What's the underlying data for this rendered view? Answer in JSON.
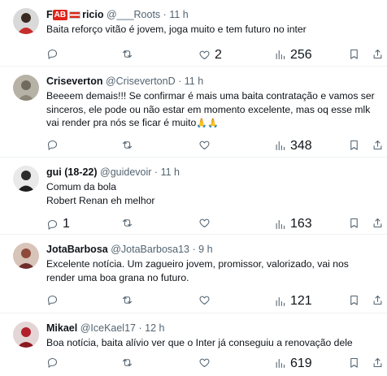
{
  "tweets": [
    {
      "name_prefix": "F",
      "name_badge": "AB",
      "name_suffix": "ricio",
      "handle": "@___Roots",
      "time": "11 h",
      "text": "Baita reforço vitão é jovem, joga muito e tem futuro no inter",
      "likes": "2",
      "views": "256",
      "avatar_colors": [
        "#c62d2d",
        "#3a2a22"
      ]
    },
    {
      "name": "Criseverton",
      "handle": "@CrisevertonD",
      "time": "11 h",
      "text": "Beeeem demais!!! Se confirmar é mais uma baita contratação e vamos ser sinceros, ele pode ou não estar em momento excelente, mas oq esse mlk vai render pra nós se ficar é muito",
      "emoji": "🙏🙏",
      "views": "348",
      "avatar_colors": [
        "#b7b2a6",
        "#6f6a5d"
      ]
    },
    {
      "name": "gui (18-22)",
      "handle": "@guidevoir",
      "time": "11 h",
      "text_lines": [
        "Comum da bola",
        "Robert Renan eh melhor"
      ],
      "replies": "1",
      "views": "163",
      "avatar_colors": [
        "#2c2c2c",
        "#e9e9e9"
      ]
    },
    {
      "name": "JotaBarbosa",
      "handle": "@JotaBarbosa13",
      "time": "9 h",
      "text": "Excelente notícia. Um zagueiro jovem, promissor, valorizado, vai nos render uma boa grana no futuro.",
      "views": "121",
      "avatar_colors": [
        "#d8c4b9",
        "#8e4a3b"
      ]
    },
    {
      "name": "Mikael",
      "handle": "@IceKael17",
      "time": "12 h",
      "text": "Boa notícia, baita alívio ver que o Inter já conseguiu a renovação dele",
      "views": "619",
      "avatar_colors": [
        "#e4d6d6",
        "#b31f2a"
      ]
    }
  ],
  "separator": "·"
}
